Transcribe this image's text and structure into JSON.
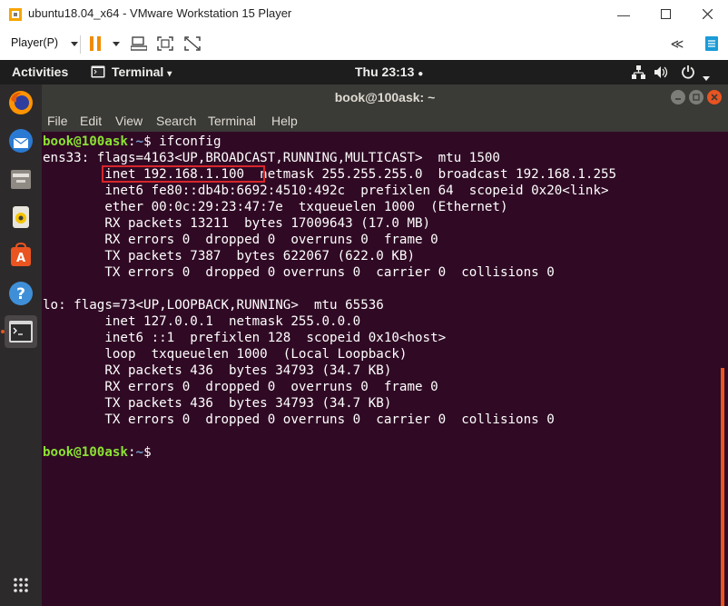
{
  "vmware": {
    "window_title": "ubuntu18.04_x64 - VMware Workstation 15 Player",
    "player_menu_label": "Player(P)",
    "colors": {
      "pause": "#f08c00",
      "accent": "#1b9bd7"
    }
  },
  "gnome": {
    "activities": "Activities",
    "app_menu": "Terminal",
    "clock": "Thu 23:13"
  },
  "dock": {
    "apps": [
      {
        "name": "Firefox",
        "icon": "firefox-icon"
      },
      {
        "name": "Thunderbird",
        "icon": "thunderbird-icon"
      },
      {
        "name": "Files",
        "icon": "files-icon"
      },
      {
        "name": "Rhythmbox",
        "icon": "rhythmbox-icon"
      },
      {
        "name": "Ubuntu Software",
        "icon": "software-icon"
      },
      {
        "name": "Help",
        "icon": "help-icon"
      },
      {
        "name": "Terminal",
        "icon": "terminal-icon"
      }
    ],
    "show_apps_icon": "app-grid-icon"
  },
  "terminal": {
    "window_title": "book@100ask: ~",
    "menu": [
      "File",
      "Edit",
      "View",
      "Search",
      "Terminal",
      "Help"
    ],
    "prompt_user": "book@100ask",
    "prompt_path": "~",
    "command": "ifconfig",
    "output": [
      "ens33: flags=4163<UP,BROADCAST,RUNNING,MULTICAST>  mtu 1500",
      "        inet 192.168.1.100  netmask 255.255.255.0  broadcast 192.168.1.255",
      "        inet6 fe80::db4b:6692:4510:492c  prefixlen 64  scopeid 0x20<link>",
      "        ether 00:0c:29:23:47:7e  txqueuelen 1000  (Ethernet)",
      "        RX packets 13211  bytes 17009643 (17.0 MB)",
      "        RX errors 0  dropped 0  overruns 0  frame 0",
      "        TX packets 7387  bytes 622067 (622.0 KB)",
      "        TX errors 0  dropped 0 overruns 0  carrier 0  collisions 0",
      "",
      "lo: flags=73<UP,LOOPBACK,RUNNING>  mtu 65536",
      "        inet 127.0.0.1  netmask 255.0.0.0",
      "        inet6 ::1  prefixlen 128  scopeid 0x10<host>",
      "        loop  txqueuelen 1000  (Local Loopback)",
      "        RX packets 436  bytes 34793 (34.7 KB)",
      "        RX errors 0  dropped 0  overruns 0  frame 0",
      "        TX packets 436  bytes 34793 (34.7 KB)",
      "        TX errors 0  dropped 0 overruns 0  carrier 0  collisions 0",
      ""
    ],
    "colors": {
      "background": "#300a24",
      "prompt_user": "#8ae234",
      "prompt_path": "#729fcf",
      "highlight": "#d6262a"
    }
  }
}
